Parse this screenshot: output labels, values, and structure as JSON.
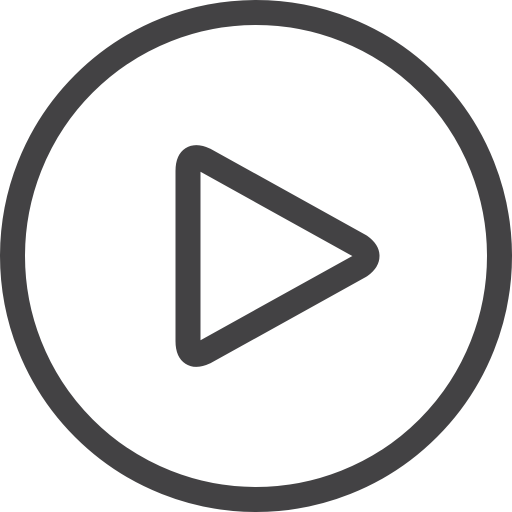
{
  "icon": {
    "name": "play-circle-icon",
    "stroke_color": "#434244",
    "background_color": "#ffffff"
  }
}
